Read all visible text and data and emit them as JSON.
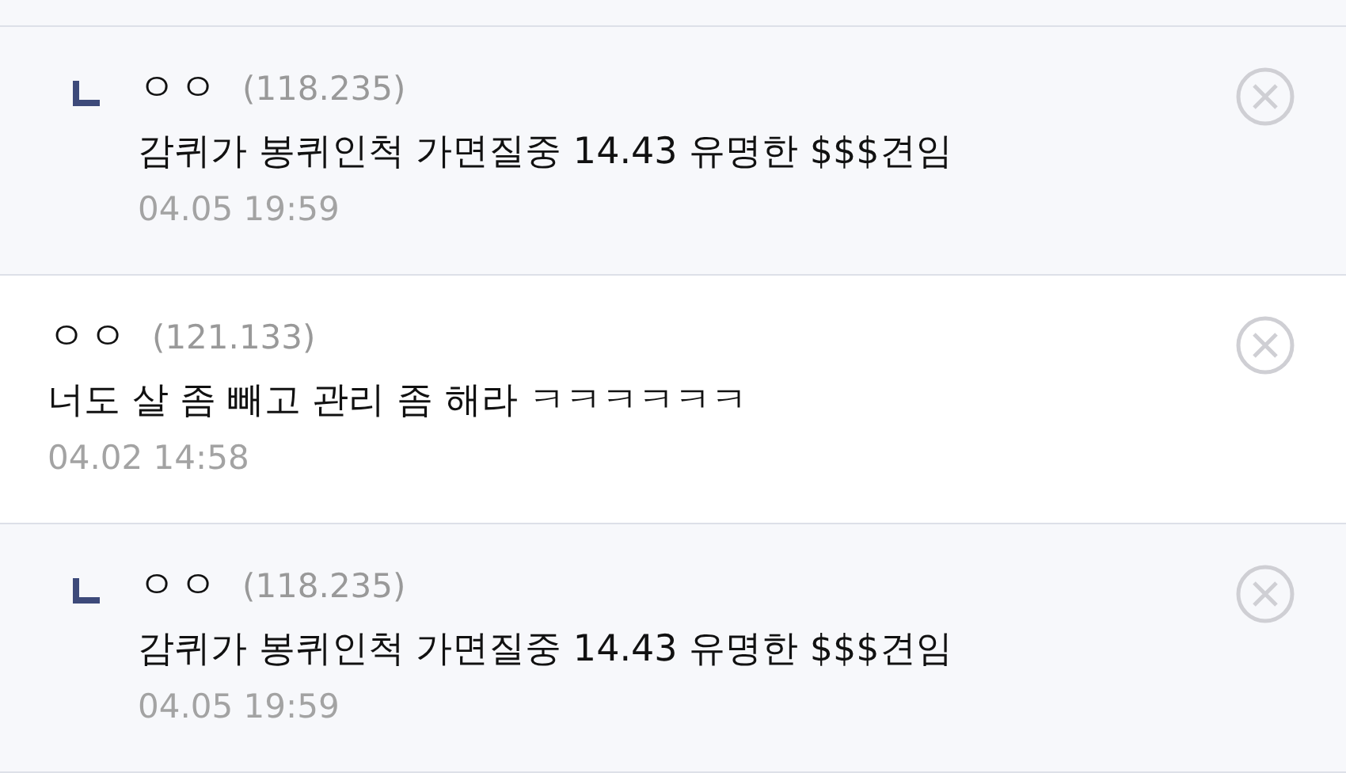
{
  "comments": [
    {
      "kind": "reply",
      "author": "ㅇㅇ",
      "ip": "(118.235)",
      "text": "감퀴가 봉퀴인척 가면질중 14.43 유명한 $$$견임",
      "time": "04.05 19:59"
    },
    {
      "kind": "comment",
      "author": "ㅇㅇ",
      "ip": "(121.133)",
      "text": "너도 살 좀 빼고 관리 좀 해라 ㅋㅋㅋㅋㅋㅋ",
      "time": "04.02 14:58"
    },
    {
      "kind": "reply",
      "author": "ㅇㅇ",
      "ip": "(118.235)",
      "text": "감퀴가 봉퀴인척 가면질중 14.43 유명한 $$$견임",
      "time": "04.05 19:59"
    }
  ]
}
